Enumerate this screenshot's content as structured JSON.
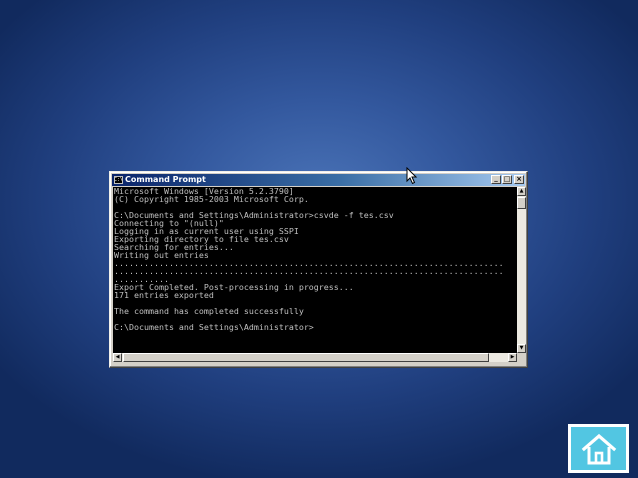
{
  "window": {
    "title": "Command Prompt",
    "buttons": {
      "minimize": "_",
      "maximize": "□",
      "close": "×"
    }
  },
  "console": {
    "lines": [
      "Microsoft Windows [Version 5.2.3790]",
      "(C) Copyright 1985-2003 Microsoft Corp.",
      "",
      "C:\\Documents and Settings\\Administrator>csvde -f tes.csv",
      "Connecting to \"(null)\"",
      "Logging in as current user using SSPI",
      "Exporting directory to file tes.csv",
      "Searching for entries...",
      "Writing out entries",
      "..............................................................................",
      "..............................................................................",
      "...........",
      "Export Completed. Post-processing in progress...",
      "171 entries exported",
      "",
      "The command has completed successfully",
      "",
      "C:\\Documents and Settings\\Administrator>"
    ]
  },
  "scrollbars": {
    "up_arrow": "▲",
    "down_arrow": "▼",
    "left_arrow": "◀",
    "right_arrow": "▶"
  },
  "icons": {
    "title_icon": "cmd-icon",
    "cursor": "mouse-pointer-icon",
    "home": "home-icon"
  },
  "colors": {
    "console_bg": "#000000",
    "console_text": "#c0c0c0",
    "title_gradient_start": "#0a246a",
    "title_gradient_end": "#a6caf0",
    "home_button": "#52c6e2",
    "background_center": "#4b74b8",
    "background_edge": "#112a5e"
  }
}
